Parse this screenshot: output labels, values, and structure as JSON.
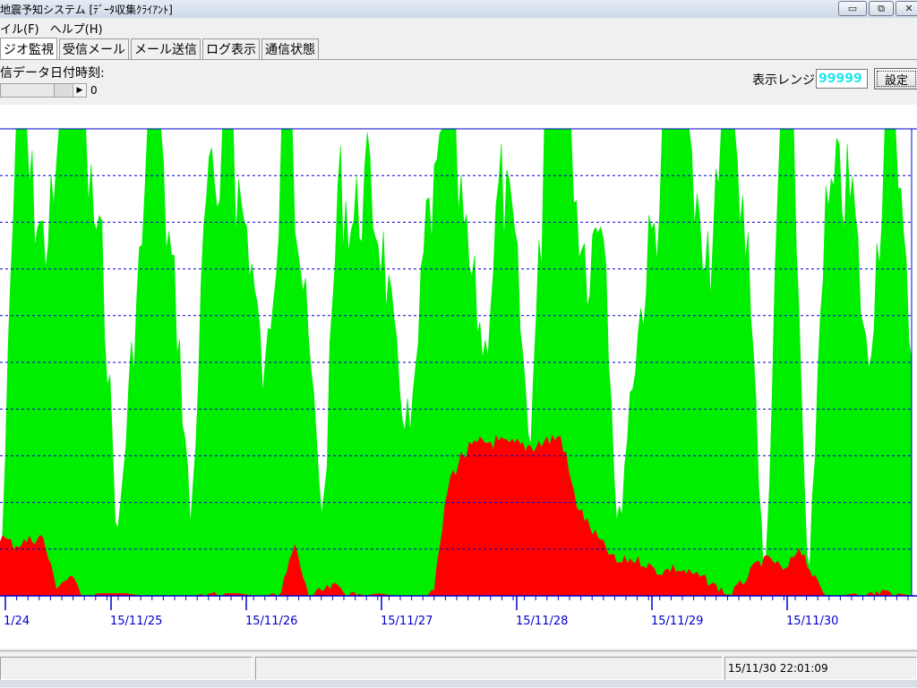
{
  "window": {
    "title": "地震予知システム [ﾃﾞｰﾀ収集ｸﾗｲｱﾝﾄ]",
    "buttons": {
      "minimize": "▭",
      "maximize": "⧉",
      "close": "✕"
    }
  },
  "menu": {
    "items": [
      "イル(F)",
      "ヘルプ(H)"
    ]
  },
  "tabs": [
    "ジオ監視",
    "受信メール",
    "メール送信",
    "ログ表示",
    "通信状態"
  ],
  "active_tab": "ジオ監視",
  "toolbar": {
    "data_datetime_label": "信データ日付時刻:",
    "scroll_value": "0",
    "range_label": "表示レンジ:",
    "range_value": "99999",
    "set_button": "設定"
  },
  "chart_data": {
    "type": "area",
    "x_tick_labels": [
      "1/24",
      "15/11/25",
      "15/11/26",
      "15/11/27",
      "15/11/28",
      "15/11/29",
      "15/11/30"
    ],
    "grid": true,
    "colors": {
      "series_a": "#00ee00",
      "series_b": "#ff0000",
      "axis": "#0000cc",
      "grid": "#0000cc"
    },
    "series": [
      {
        "color": "#00ee00",
        "envelope": [
          0,
          100,
          100,
          85,
          100,
          100,
          100,
          80,
          15,
          60,
          100,
          100,
          70,
          18,
          95,
          100,
          100,
          85,
          50,
          100,
          100,
          60,
          20,
          100,
          90,
          100,
          85,
          55,
          40,
          90,
          100,
          100,
          78,
          60,
          100,
          85,
          38,
          100,
          100,
          100,
          80,
          100,
          15,
          55,
          80,
          100,
          100,
          100,
          75,
          100,
          100,
          82,
          0,
          100,
          100,
          0,
          88,
          100,
          96,
          55,
          100,
          100,
          60
        ]
      },
      {
        "color": "#ff0000",
        "envelope": [
          14,
          12,
          13,
          14,
          3,
          5,
          1,
          0.5,
          0.5,
          0.5,
          0,
          0,
          0,
          0,
          0,
          1,
          0.5,
          0.5,
          0,
          0,
          1,
          12,
          0.5,
          2,
          3,
          1,
          0,
          0.5,
          0,
          0,
          0,
          3,
          26,
          32,
          34,
          35,
          34,
          34,
          34,
          35,
          36,
          22,
          16,
          12,
          8,
          9,
          8,
          6,
          7,
          6,
          5,
          3,
          1,
          4,
          8,
          9,
          6,
          12,
          5,
          0,
          0,
          0.5,
          1,
          2,
          0.5,
          0
        ]
      }
    ]
  },
  "status": {
    "panel1": "",
    "panel2": "",
    "datetime": "15/11/30 22:01:09"
  }
}
